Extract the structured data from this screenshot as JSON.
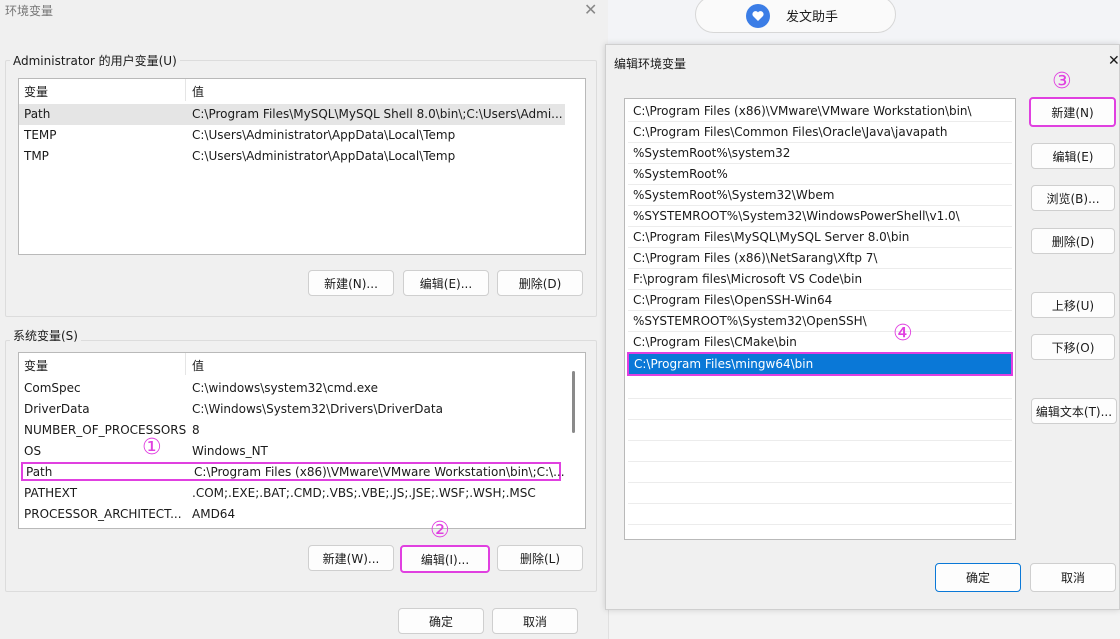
{
  "env_dialog": {
    "title": "环境变量",
    "close_glyph": "✕",
    "user_group_label": "Administrator 的用户变量(U)",
    "sys_group_label": "系统变量(S)",
    "col_var": "变量",
    "col_val": "值",
    "user_vars": [
      {
        "name": "Path",
        "value": "C:\\Program Files\\MySQL\\MySQL Shell 8.0\\bin\\;C:\\Users\\Admi..."
      },
      {
        "name": "TEMP",
        "value": "C:\\Users\\Administrator\\AppData\\Local\\Temp"
      },
      {
        "name": "TMP",
        "value": "C:\\Users\\Administrator\\AppData\\Local\\Temp"
      }
    ],
    "sys_vars": [
      {
        "name": "ComSpec",
        "value": "C:\\windows\\system32\\cmd.exe"
      },
      {
        "name": "DriverData",
        "value": "C:\\Windows\\System32\\Drivers\\DriverData"
      },
      {
        "name": "NUMBER_OF_PROCESSORS",
        "value": "8"
      },
      {
        "name": "OS",
        "value": "Windows_NT"
      },
      {
        "name": "Path",
        "value": "C:\\Program Files (x86)\\VMware\\VMware Workstation\\bin\\;C:\\..."
      },
      {
        "name": "PATHEXT",
        "value": ".COM;.EXE;.BAT;.CMD;.VBS;.VBE;.JS;.JSE;.WSF;.WSH;.MSC"
      },
      {
        "name": "PROCESSOR_ARCHITECT...",
        "value": "AMD64"
      }
    ],
    "user_buttons": {
      "new": "新建(N)...",
      "edit": "编辑(E)...",
      "delete": "删除(D)"
    },
    "sys_buttons": {
      "new": "新建(W)...",
      "edit": "编辑(I)...",
      "delete": "删除(L)"
    },
    "ok": "确定",
    "cancel": "取消"
  },
  "helper": {
    "label": "发文助手"
  },
  "edit_dialog": {
    "title": "编辑环境变量",
    "close_glyph": "✕",
    "paths": [
      "C:\\Program Files (x86)\\VMware\\VMware Workstation\\bin\\",
      "C:\\Program Files\\Common Files\\Oracle\\Java\\javapath",
      "%SystemRoot%\\system32",
      "%SystemRoot%",
      "%SystemRoot%\\System32\\Wbem",
      "%SYSTEMROOT%\\System32\\WindowsPowerShell\\v1.0\\",
      "C:\\Program Files\\MySQL\\MySQL Server 8.0\\bin",
      "C:\\Program Files (x86)\\NetSarang\\Xftp 7\\",
      "F:\\program files\\Microsoft VS Code\\bin",
      "C:\\Program Files\\OpenSSH-Win64",
      "%SYSTEMROOT%\\System32\\OpenSSH\\",
      "C:\\Program Files\\CMake\\bin",
      "C:\\Program Files\\mingw64\\bin"
    ],
    "buttons": {
      "new": "新建(N)",
      "edit": "编辑(E)",
      "browse": "浏览(B)...",
      "delete": "删除(D)",
      "move_up": "上移(U)",
      "move_down": "下移(O)",
      "edit_text": "编辑文本(T)..."
    },
    "ok": "确定",
    "cancel": "取消"
  },
  "annotations": {
    "one": "①",
    "two": "②",
    "three": "③",
    "four": "④"
  },
  "colors": {
    "highlight": "#e040e0",
    "selection": "#0a78d7"
  }
}
